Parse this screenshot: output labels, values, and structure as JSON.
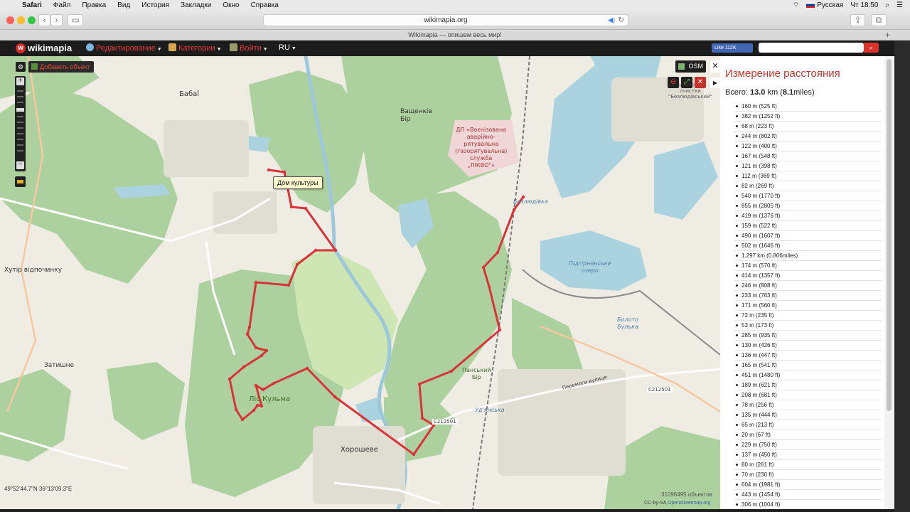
{
  "menubar": {
    "app": "Safari",
    "items": [
      "Файл",
      "Правка",
      "Вид",
      "История",
      "Закладки",
      "Окно",
      "Справка"
    ],
    "input_lang": "Русская",
    "clock": "Чт 18:50"
  },
  "browser": {
    "url": "wikimapia.org",
    "tab_title": "Wikimapia — опишем весь мир!"
  },
  "header": {
    "logo": "wikimapia",
    "menu_edit": "Редактирование",
    "menu_categories": "Категории",
    "menu_login": "Войти",
    "lang": "RU",
    "fb_like": "Like 112K",
    "search_placeholder": ""
  },
  "map": {
    "add_object": "Добавить объект",
    "layer": "OSM",
    "tooltip": "Дом культуры",
    "coords": "49°52'44.7\"N 36°13'09.3\"E",
    "object_count": "31096495 объектов",
    "credit_prefix": "CC-by-SA",
    "credit_link": "Openstreetmap.org",
    "labels": {
      "babai": "Бабаї",
      "vashchenkiv_bir": "Ващенків\nБір",
      "dp_likvo": "ДП «Воєнізована\nаварійно-\nрятувальна\n(газорятувальна)\nслужба\n„ЛІКВО\"»",
      "bezliudivka": "Безлюдівка",
      "pidhirnske_ozero": "Підгірнянське\nозеро",
      "khutir": "Хутір відпочинку",
      "zatyshne": "Затишне",
      "lis_kulma": "Ліс Кульма",
      "panskyi_bir": "Панський\nБір",
      "udianska": "Уд'янська",
      "khoroshev": "Хорошеве",
      "c212501_a": "C212501",
      "c212501_b": "C212501",
      "peremohy": "Перемоги вулиця",
      "boloto": "Болото\nБулька",
      "bio_cleaning": "біологічної\nочистки\n\"Безлюдівський\""
    }
  },
  "panel": {
    "title": "Измерение расстояния",
    "total_prefix": "Всего:",
    "total_km": "13.0",
    "total_km_unit": "km",
    "total_miles": "8.1",
    "total_miles_unit": "miles",
    "segments": [
      "160 m (525 ft)",
      "382 m (1252 ft)",
      "68 m (223 ft)",
      "244 m (802 ft)",
      "122 m (400 ft)",
      "167 m (548 ft)",
      "121 m (398 ft)",
      "112 m (369 ft)",
      "82 m (269 ft)",
      "540 m (1770 ft)",
      "855 m (2805 ft)",
      "419 m (1376 ft)",
      "159 m (522 ft)",
      "490 m (1607 ft)",
      "502 m (1646 ft)",
      "1.297 km (0.806miles)",
      "174 m (570 ft)",
      "414 m (1357 ft)",
      "246 m (808 ft)",
      "233 m (763 ft)",
      "171 m (560 ft)",
      "72 m (235 ft)",
      "53 m (173 ft)",
      "285 m (935 ft)",
      "130 m (426 ft)",
      "136 m (447 ft)",
      "165 m (541 ft)",
      "451 m (1480 ft)",
      "189 m (621 ft)",
      "208 m (681 ft)",
      "78 m (256 ft)",
      "135 m (444 ft)",
      "65 m (213 ft)",
      "20 m (67 ft)",
      "229 m (750 ft)",
      "137 m (450 ft)",
      "80 m (261 ft)",
      "70 m (230 ft)",
      "604 m (1981 ft)",
      "443 m (1454 ft)",
      "306 m (1004 ft)"
    ]
  },
  "colors": {
    "route": "#d9333a",
    "forest": "#a8cc8c",
    "water": "#aad3df",
    "accent": "#c0392b"
  }
}
